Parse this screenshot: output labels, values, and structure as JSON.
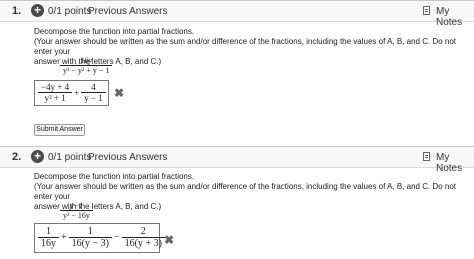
{
  "questions": [
    {
      "number": "1.",
      "points": "0/1 points",
      "previous_answers": "Previous Answers",
      "notes": "My Notes",
      "prompt": "Decompose the function into partial fractions.",
      "instructions_line1": "(Your answer should be written as the sum and/or difference of the fractions, including the values of A, B, and C. Do not enter your",
      "instructions_line2": "answer with the letters A, B, and C.)",
      "function_num": "16y",
      "function_den": "y³ − y² + y − 1",
      "answer": [
        {
          "num": "−4y + 4",
          "den": "y² + 1"
        },
        {
          "op": "+"
        },
        {
          "num": "4",
          "den": "y − 1"
        }
      ],
      "submit_label": "Submit Answer"
    },
    {
      "number": "2.",
      "points": "0/1 points",
      "previous_answers": "Previous Answers",
      "notes": "My Notes",
      "prompt": "Decompose the function into partial fractions.",
      "instructions_line1": "(Your answer should be written as the sum and/or difference of the fractions, including the values of A, B, and C. Do not enter your",
      "instructions_line2": "answer with the letters A, B, and C.)",
      "function_num": "y−1",
      "function_den": "y³ − 16y",
      "answer": [
        {
          "num": "1",
          "den": "16y"
        },
        {
          "op": "+"
        },
        {
          "num": "1",
          "den": "16(y − 3)"
        },
        {
          "op": "−"
        },
        {
          "num": "2",
          "den": "16(y + 3)"
        }
      ]
    }
  ],
  "status_icon": "x-icon",
  "header_icon": "plus-circle-icon"
}
